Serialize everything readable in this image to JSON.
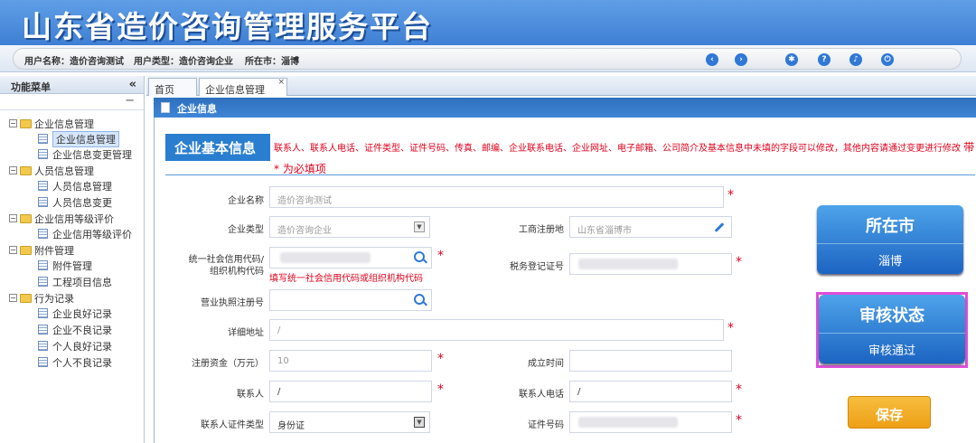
{
  "app": {
    "title": "山东省造价咨询管理服务平台"
  },
  "userbar": {
    "username": "用户名称：造价咨询测试",
    "usertype": "用户类型：造价咨询企业",
    "city": "所在市：淄博",
    "icons": [
      "back-icon",
      "forward-icon",
      "gear-icon",
      "help-icon",
      "bell-icon",
      "power-icon"
    ]
  },
  "sidebar": {
    "title": "功能菜单",
    "collapse": "«",
    "minus": "−",
    "groups": [
      {
        "label": "企业信息管理",
        "items": [
          "企业信息管理",
          "企业信息变更管理"
        ]
      },
      {
        "label": "人员信息管理",
        "items": [
          "人员信息管理",
          "人员信息变更"
        ]
      },
      {
        "label": "企业信用等级评价",
        "items": [
          "企业信用等级评价"
        ]
      },
      {
        "label": "附件管理",
        "items": [
          "附件管理",
          "工程项目信息"
        ]
      },
      {
        "label": "行为记录",
        "items": [
          "企业良好记录",
          "企业不良记录",
          "个人良好记录",
          "个人不良记录"
        ]
      }
    ]
  },
  "tabs": [
    {
      "label": "首页"
    },
    {
      "label": "企业信息管理"
    }
  ],
  "tab_close": "×",
  "panel": {
    "title": "企业信息"
  },
  "section": {
    "title": "企业基本信息",
    "notice": "联系人、联系人电话、证件类型、证件号码、传真、邮编、企业联系电话、企业网址、电子邮箱、公司简介及基本信息中未填的字段可以修改，其他内容请通过变更进行修改",
    "notice_star": "带 * 为必填项"
  },
  "form": {
    "company_name": {
      "label": "企业名称",
      "value": "造价咨询测试"
    },
    "company_type": {
      "label": "企业类型",
      "value": "造价咨询企业"
    },
    "reg_place": {
      "label": "工商注册地",
      "value": "山东省淄博市"
    },
    "credit_code": {
      "label": "统一社会信用代码/组织机构代码",
      "hint": "填写统一社会信用代码或组织机构代码"
    },
    "tax_no": {
      "label": "税务登记证号"
    },
    "license_no": {
      "label": "营业执照注册号"
    },
    "address": {
      "label": "详细地址",
      "value": "/"
    },
    "capital": {
      "label": "注册资金（万元）",
      "value": "10"
    },
    "found_date": {
      "label": "成立时间"
    },
    "contact": {
      "label": "联系人",
      "value": "/"
    },
    "contact_phone": {
      "label": "联系人电话",
      "value": "/"
    },
    "id_type": {
      "label": "联系人证件类型",
      "value": "身份证"
    },
    "id_no": {
      "label": "证件号码"
    },
    "required_mark": "*"
  },
  "cards": {
    "city": {
      "title": "所在市",
      "value": "淄博"
    },
    "status": {
      "title": "审核状态",
      "value": "审核通过"
    }
  },
  "save_label": "保存",
  "colors": {
    "header": "#3f7fd4",
    "accent": "#2a7ed0",
    "required": "#e0001b",
    "highlight": "#e04ddb",
    "save": "#ee9f16"
  }
}
